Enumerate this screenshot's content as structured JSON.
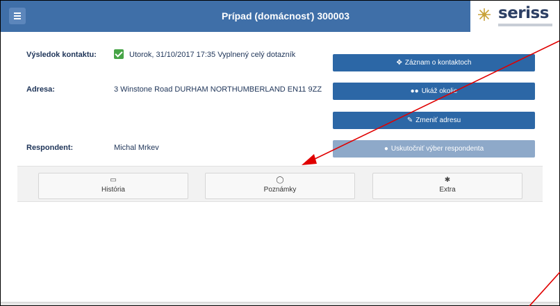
{
  "header": {
    "title": "Prípad (domácnosť) 300003",
    "logo_text": "seriss",
    "brand_color": "#3f6fa8"
  },
  "fields": {
    "result_label": "Výsledok kontaktu:",
    "result_value": "Utorok, 31/10/2017 17:35 Vyplnený celý dotazník",
    "address_label": "Adresa:",
    "address_value": "3 Winstone Road DURHAM NORTHUMBERLAND EN11 9ZZ",
    "respondent_label": "Respondent:",
    "respondent_value": "Michal Mrkev"
  },
  "actions": {
    "contact_record": "Záznam o kontaktoch",
    "show_surroundings": "Ukáž okolie",
    "change_address": "Zmeniť adresu",
    "select_respondent": "Uskutočniť výber respondenta"
  },
  "tabs": {
    "history": "História",
    "notes": "Poznámky",
    "extra": "Extra"
  },
  "icons": {
    "menu": "hamburger-icon",
    "result": "checkmark-icon",
    "contact_record": "arrows-icon",
    "show_surroundings": "binoculars-icon",
    "change_address": "edit-icon",
    "select_respondent": "user-icon",
    "history": "calendar-icon",
    "notes": "speech-bubble-icon",
    "extra": "gear-icon"
  },
  "annotation_color": "#e00000"
}
